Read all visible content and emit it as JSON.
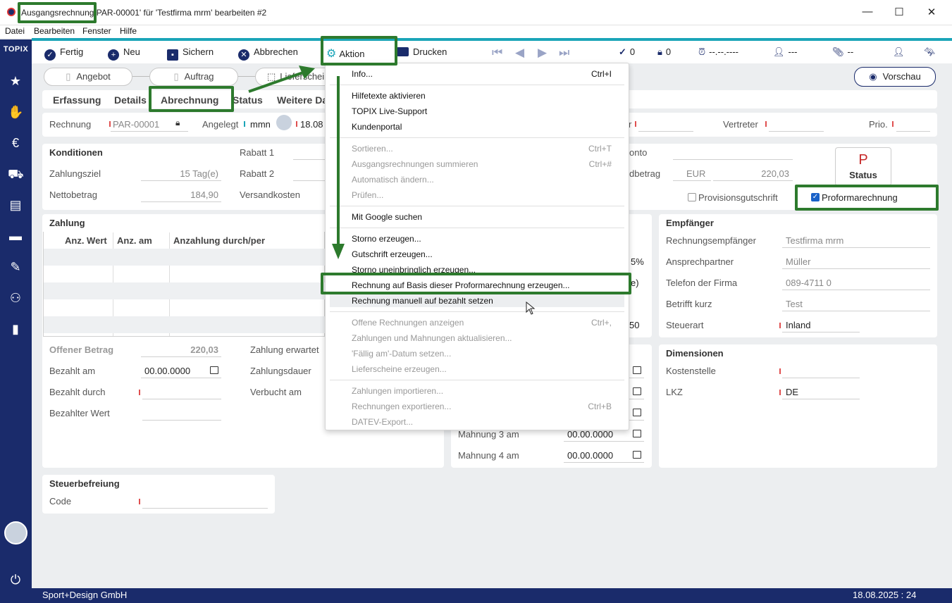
{
  "window": {
    "title_prefix": "Ausgangsrechnung",
    "title_rest": "PAR-00001' für 'Testfirma mrm' bearbeiten #2",
    "minimize": "—",
    "maximize": "☐",
    "close": "✕"
  },
  "menubar": [
    "Datei",
    "Bearbeiten",
    "Fenster",
    "Hilfe"
  ],
  "sidebar": {
    "logo": "TOPIX"
  },
  "toolbar": {
    "fertig": "Fertig",
    "neu": "Neu",
    "sichern": "Sichern",
    "abbrechen": "Abbrechen",
    "aktion": "Aktion",
    "drucken": "Drucken",
    "check_count": "0",
    "lock_count": "0",
    "alarm_date": "--.--.----",
    "user_value": "---",
    "clip_value": "--"
  },
  "flow": {
    "angebot": "Angebot",
    "auftrag": "Auftrag",
    "lieferschein": "Lieferschein",
    "vorschau": "Vorschau"
  },
  "tabs": [
    "Erfassung",
    "Details",
    "Abrechnung",
    "Status",
    "Weitere Da"
  ],
  "header_row": {
    "rechnung_label": "Rechnung",
    "rechnung_value": "PAR-00001",
    "angelegt_label": "Angelegt",
    "angelegt_user": "mmn",
    "angelegt_date": "18.08",
    "vertreter_label": "Vertreter",
    "prio_label": "Prio."
  },
  "konditionen": {
    "title": "Konditionen",
    "zahlungsziel_label": "Zahlungsziel",
    "zahlungsziel_value": "15 Tag(e)",
    "nettobetrag_label": "Nettobetrag",
    "nettobetrag_value": "184,90",
    "rabatt1_label": "Rabatt 1",
    "rabatt2_label": "Rabatt 2",
    "versandkosten_label": "Versandkosten",
    "konto_label": "onto",
    "betrag_label": "dbetrag",
    "currency": "EUR",
    "betrag_value": "220,03",
    "status_letter": "P",
    "status_label": "Status",
    "provision_label": "Provisionsgutschrift",
    "proforma_label": "Proformarechnung"
  },
  "zahlung": {
    "title": "Zahlung",
    "col1": "Anz. Wert",
    "col2": "Anz. am",
    "col3": "Anzahlung durch/per",
    "offener_label": "Offener Betrag",
    "offener_value": "220,03",
    "bezahlt_am_label": "Bezahlt am",
    "bezahlt_am_value": "00.00.0000",
    "bezahlt_durch_label": "Bezahlt durch",
    "bezahlter_wert_label": "Bezahlter Wert",
    "zahlung_erwartet_label": "Zahlung erwartet",
    "zahlungsdauer_label": "Zahlungsdauer",
    "verbucht_label": "Verbucht am"
  },
  "mahnung": {
    "pct": "5%",
    "paren": "e)",
    "num": "50",
    "m3_label": "Mahnung 3 am",
    "m3_value": "00.00.0000",
    "m4_label": "Mahnung 4 am",
    "m4_value": "00.00.0000"
  },
  "empfaenger": {
    "title": "Empfänger",
    "rows": [
      {
        "label": "Rechnungsempfänger",
        "value": "Testfirma mrm"
      },
      {
        "label": "Ansprechpartner",
        "value": "Müller"
      },
      {
        "label": "Telefon der Firma",
        "value": "089-4711 0"
      },
      {
        "label": "Betrifft kurz",
        "value": "Test"
      },
      {
        "label": "Steuerart",
        "value": "Inland"
      }
    ]
  },
  "dimensionen": {
    "title": "Dimensionen",
    "kostenstelle_label": "Kostenstelle",
    "lkz_label": "LKZ",
    "lkz_value": "DE"
  },
  "steuer": {
    "title": "Steuerbefreiung",
    "code_label": "Code"
  },
  "menu": {
    "items": [
      {
        "label": "Info...",
        "shortcut": "Ctrl+I",
        "disabled": false
      },
      {
        "label": "Hilfetexte aktivieren",
        "shortcut": "",
        "disabled": false
      },
      {
        "label": "TOPIX Live-Support",
        "shortcut": "",
        "disabled": false
      },
      {
        "label": "Kundenportal",
        "shortcut": "",
        "disabled": false
      },
      {
        "label": "Sortieren...",
        "shortcut": "Ctrl+T",
        "disabled": true
      },
      {
        "label": "Ausgangsrechnungen summieren",
        "shortcut": "Ctrl+#",
        "disabled": true
      },
      {
        "label": "Automatisch ändern...",
        "shortcut": "",
        "disabled": true
      },
      {
        "label": "Prüfen...",
        "shortcut": "",
        "disabled": true
      },
      {
        "label": "Mit Google suchen",
        "shortcut": "",
        "disabled": false
      },
      {
        "label": "Storno erzeugen...",
        "shortcut": "",
        "disabled": false
      },
      {
        "label": "Gutschrift erzeugen...",
        "shortcut": "",
        "disabled": false
      },
      {
        "label": "Storno uneinbringlich erzeugen...",
        "shortcut": "",
        "disabled": false
      },
      {
        "label": "Rechnung auf Basis dieser Proformarechnung erzeugen...",
        "shortcut": "",
        "disabled": false
      },
      {
        "label": "Rechnung manuell auf bezahlt setzen",
        "shortcut": "",
        "disabled": false
      },
      {
        "label": "Offene Rechnungen anzeigen",
        "shortcut": "Ctrl+,",
        "disabled": true
      },
      {
        "label": "Zahlungen und Mahnungen aktualisieren...",
        "shortcut": "",
        "disabled": true
      },
      {
        "label": "'Fällig am'-Datum setzen...",
        "shortcut": "",
        "disabled": true
      },
      {
        "label": "Lieferscheine erzeugen...",
        "shortcut": "",
        "disabled": true
      },
      {
        "label": "Zahlungen importieren...",
        "shortcut": "",
        "disabled": true
      },
      {
        "label": "Rechnungen exportieren...",
        "shortcut": "Ctrl+B",
        "disabled": true
      },
      {
        "label": "DATEV-Export...",
        "shortcut": "",
        "disabled": true
      }
    ]
  },
  "statusbar": {
    "company": "Sport+Design GmbH",
    "datetime": "18.08.2025 : 24"
  },
  "colors": {
    "sidebar": "#1a2b6b",
    "accent": "#1ba5b8",
    "highlight": "#2d7a2d",
    "required": "#e05050"
  }
}
